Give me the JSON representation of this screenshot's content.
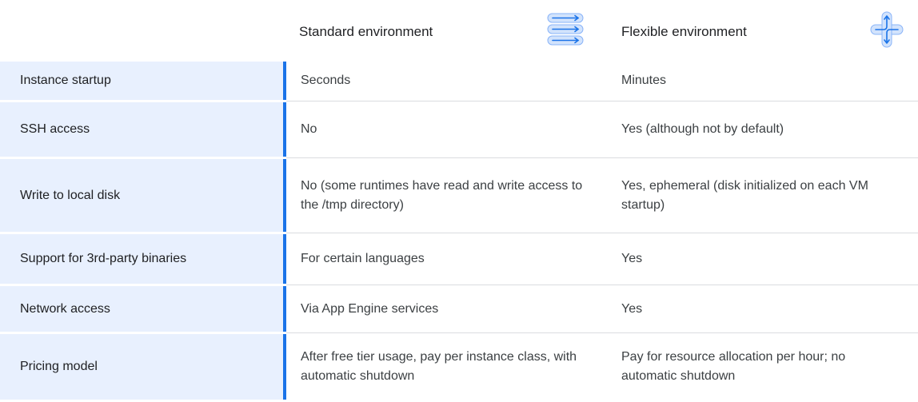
{
  "header": {
    "standard_label": "Standard environment",
    "flexible_label": "Flexible environment",
    "standard_icon": "parallel-arrows-icon",
    "flexible_icon": "branching-arrows-icon"
  },
  "colors": {
    "accent": "#1a73e8",
    "row_label_bg": "#e8f0fe",
    "divider": "#dadce0"
  },
  "rows": [
    {
      "label": "Instance startup",
      "standard": "Seconds",
      "flexible": "Minutes"
    },
    {
      "label": "SSH access",
      "standard": "No",
      "flexible": "Yes (although not by default)"
    },
    {
      "label": "Write to local disk",
      "standard": "No (some runtimes have read and write access to the /tmp directory)",
      "flexible": "Yes, ephemeral (disk initialized on each VM startup)"
    },
    {
      "label": "Support for 3rd-party binaries",
      "standard": "For certain languages",
      "flexible": "Yes"
    },
    {
      "label": "Network access",
      "standard": "Via App Engine services",
      "flexible": "Yes"
    },
    {
      "label": "Pricing model",
      "standard": "After free tier usage, pay per instance class, with automatic shutdown",
      "flexible": "Pay for resource allocation per hour; no automatic shutdown"
    }
  ]
}
